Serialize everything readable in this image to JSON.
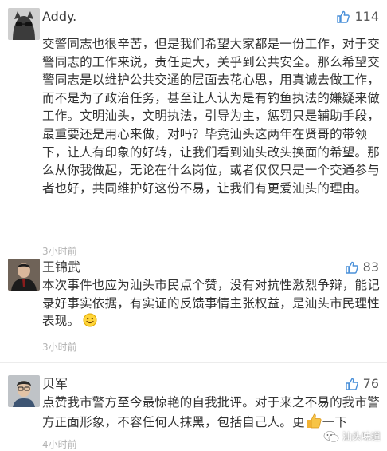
{
  "comments": [
    {
      "username": "Addy.  ",
      "likes": "114",
      "text": "交警同志也很辛苦，但是我们希望大家都是一份工作，对于交警同志的工作来说，责任更大，关乎到公共安全。那么希望交警同志是以维护公共交通的层面去花心思，用真诚去做工作，而不是为了政治任务，甚至让人认为是有钓鱼执法的嫌疑来做工作。文明汕头，文明执法，引导为主，惩罚只是辅助手段，最重要还是用心来做，对吗？毕竟汕头这两年在贤哥的带领下，让人有印象的好转，让我们看到汕头改头换面的希望。那么从你我做起，无论在什么岗位，或者仅仅只是一个交通参与者也好，共同维护好这份不易，让我们有更爱汕头的理由。",
      "time": "3小时前"
    },
    {
      "username": "王锦武",
      "likes": "83",
      "text": "本次事件也应为汕头市民点个赞，没有对抗性激烈争辩，能记录好事实依据，有实证的反馈事情主张权益，是汕头市民理性表现。",
      "time": "3小时前"
    },
    {
      "username": "贝军",
      "likes": "76",
      "text": "点赞我市警方至今最惊艳的自我批评。对于来之不易的我市警方正面形象，不容任何人抹黑，包括自己人。更",
      "text_tail": "一下",
      "time": "4小时前"
    }
  ],
  "watermark": "汕头味道",
  "icons": {
    "like": "thumbs-up-icon",
    "smile": "smile-emoji-icon",
    "thumbs": "thumbs-up-emoji-icon",
    "wechat": "wechat-icon"
  },
  "colors": {
    "like_icon": "#4a90d9",
    "time": "#b2b2b2",
    "text": "#333333"
  }
}
